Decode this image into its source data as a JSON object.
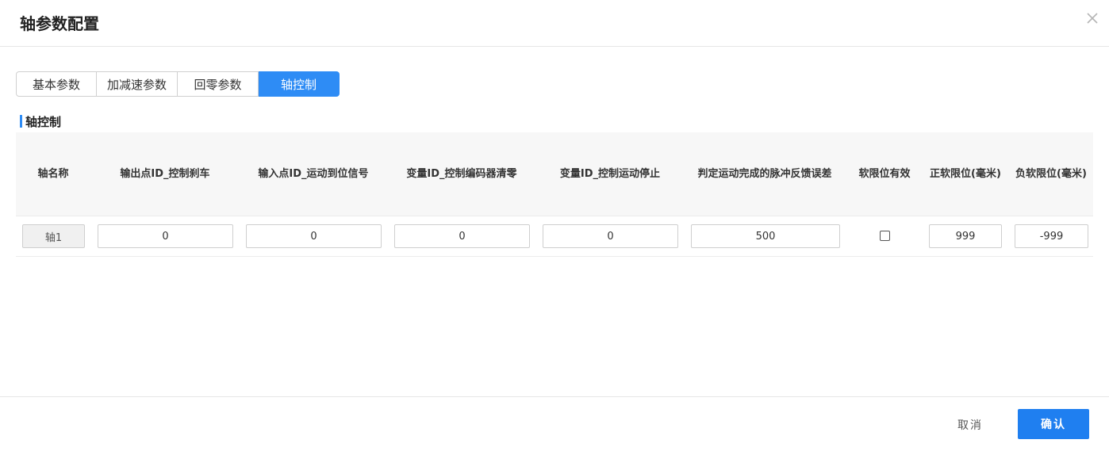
{
  "dialog": {
    "title": "轴参数配置",
    "close_icon": "close-icon"
  },
  "tabs": [
    {
      "label": "基本参数",
      "active": false
    },
    {
      "label": "加减速参数",
      "active": false
    },
    {
      "label": "回零参数",
      "active": false
    },
    {
      "label": "轴控制",
      "active": true
    }
  ],
  "section": {
    "title": "轴控制"
  },
  "table": {
    "headers": [
      {
        "label": "轴名称"
      },
      {
        "label": "输出点ID_控制刹车"
      },
      {
        "label": "输入点ID_运动到位信号"
      },
      {
        "label": "变量ID_控制编码器清零"
      },
      {
        "label": "变量ID_控制运动停止"
      },
      {
        "label": "判定运动完成的脉冲反馈误差"
      },
      {
        "label": "软限位有效"
      },
      {
        "label": "正软限位(毫米)"
      },
      {
        "label": "负软限位(毫米)"
      }
    ],
    "rows": [
      {
        "axis_name": "轴1",
        "brake_output_id": "0",
        "in_position_input_id": "0",
        "encoder_clear_var_id": "0",
        "motion_stop_var_id": "0",
        "pulse_feedback_error": "500",
        "soft_limit_enabled": false,
        "positive_soft_limit": "999",
        "negative_soft_limit": "-999"
      }
    ]
  },
  "footer": {
    "cancel_label": "取消",
    "confirm_label": "确认"
  },
  "colors": {
    "accent": "#2e8cf5",
    "confirm": "#1f7ff0"
  }
}
